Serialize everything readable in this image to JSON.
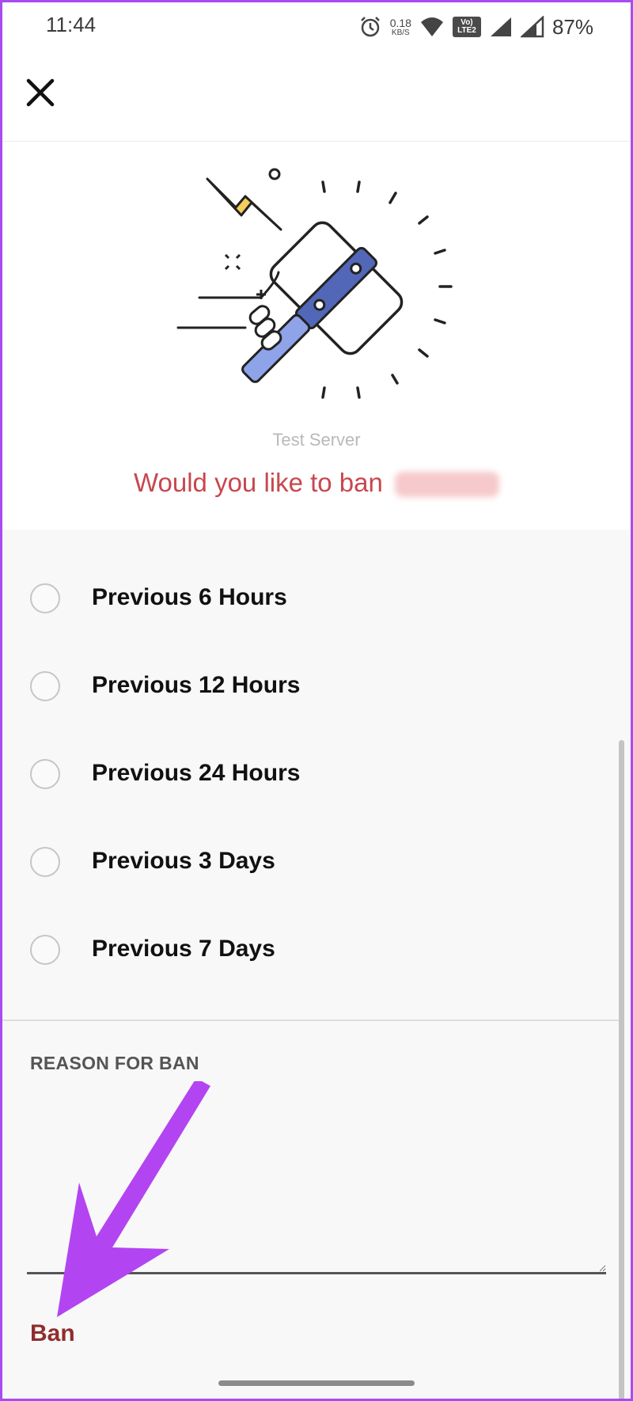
{
  "status_bar": {
    "time": "11:44",
    "net_speed_value": "0.18",
    "net_speed_unit": "KB/S",
    "volte_top": "Vo)",
    "volte_bottom": "LTE2",
    "battery": "87%",
    "icons": [
      "alarm-icon",
      "wifi-icon",
      "volte-icon",
      "signal-icon",
      "signal-icon",
      "battery"
    ]
  },
  "header": {
    "close_icon": "close-icon"
  },
  "hero": {
    "illustration": "ban-hammer-illustration",
    "server_name": "Test Server",
    "question": "Would you like to ban"
  },
  "delete_history_options": [
    {
      "label": "Previous 6 Hours",
      "selected": false
    },
    {
      "label": "Previous 12 Hours",
      "selected": false
    },
    {
      "label": "Previous 24 Hours",
      "selected": false
    },
    {
      "label": "Previous 3 Days",
      "selected": false
    },
    {
      "label": "Previous 7 Days",
      "selected": false
    }
  ],
  "reason": {
    "label": "REASON FOR BAN",
    "value": ""
  },
  "actions": {
    "ban_label": "Ban"
  },
  "colors": {
    "question": "#c8474e",
    "ban": "#8e2e2e",
    "annotation_arrow": "#b344f2",
    "hammer_accent": "#5367b8"
  }
}
